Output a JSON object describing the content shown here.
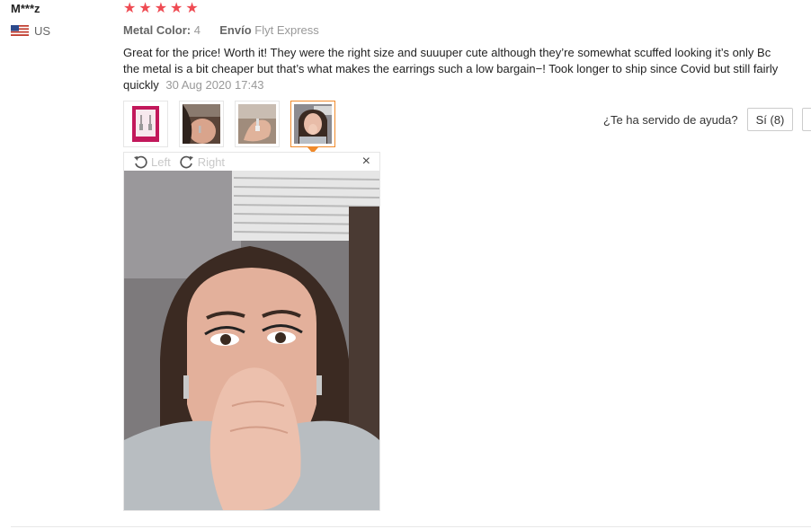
{
  "reviewer": {
    "name": "M***z",
    "country": "US"
  },
  "rating": {
    "stars": 5,
    "max": 5,
    "color": "#ef4b53"
  },
  "meta": {
    "color_label": "Metal Color:",
    "color_value": "4",
    "shipping_label": "Envío",
    "shipping_value": "Flyt Express"
  },
  "review": {
    "text": "Great for the price! Worth it! They were the right size and suuuper cute although they’re somewhat scuffed looking it’s only Bc the metal is a bit cheaper but that’s what makes the earrings such a low bargain−! Took longer to ship since Covid but still fairly quickly",
    "date": "30 Aug 2020 17:43"
  },
  "thumbnails": [
    {
      "name": "thumb-earrings-card",
      "active": false
    },
    {
      "name": "thumb-ear-closeup",
      "active": false
    },
    {
      "name": "thumb-hand-earring",
      "active": false
    },
    {
      "name": "thumb-selfie",
      "active": true
    }
  ],
  "helpful": {
    "question": "¿Te ha servido de ayuda?",
    "yes_label": "Sí (8)"
  },
  "viewer": {
    "rotate_left": "Left",
    "rotate_right": "Right",
    "close": "×"
  },
  "colors": {
    "accent": "#f08a2b",
    "star": "#ef4b53"
  }
}
